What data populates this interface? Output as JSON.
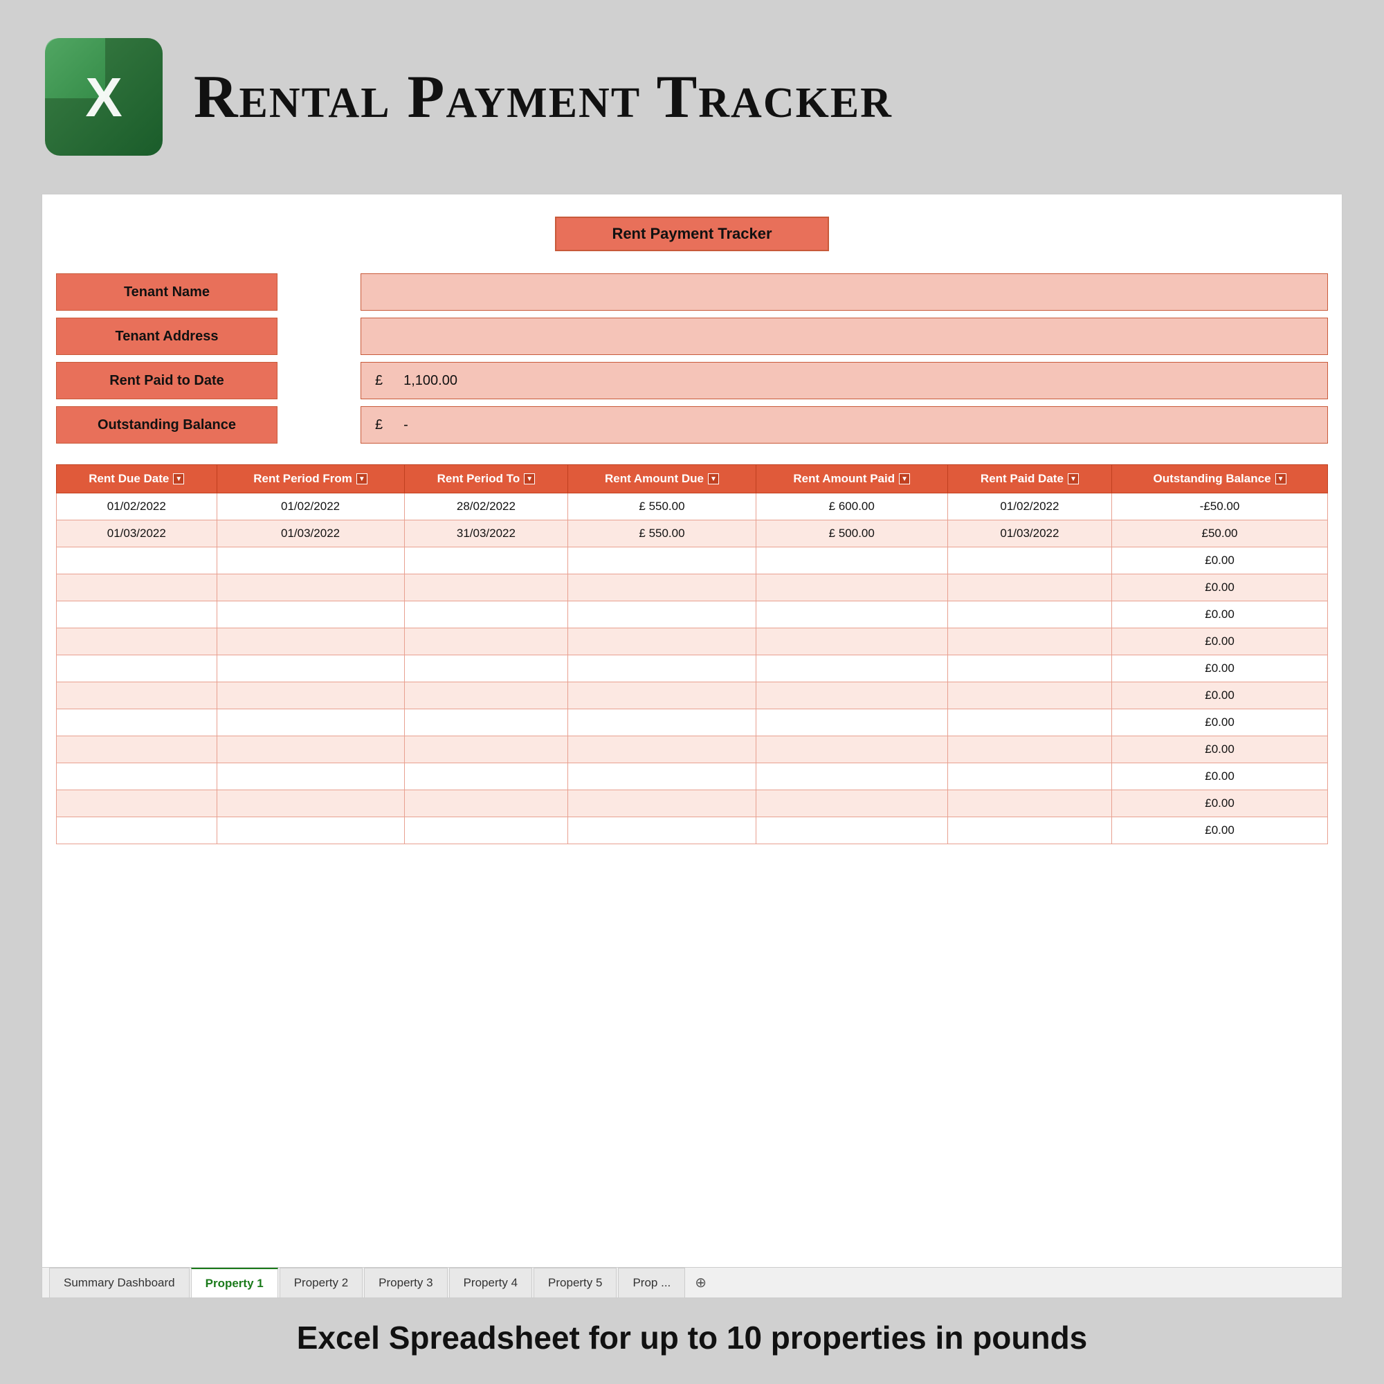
{
  "header": {
    "title": "Rental Payment Tracker",
    "excel_alt": "Excel Logo"
  },
  "spreadsheet": {
    "title": "Rent Payment Tracker",
    "info_fields": [
      {
        "label": "Tenant Name",
        "value": "",
        "has_currency": false
      },
      {
        "label": "Tenant Address",
        "value": "",
        "has_currency": false
      },
      {
        "label": "Rent Paid to Date",
        "value": "1,100.00",
        "has_currency": true
      },
      {
        "label": "Outstanding Balance",
        "value": "-",
        "has_currency": true
      }
    ],
    "table": {
      "columns": [
        "Rent Due Date",
        "Rent Period From",
        "Rent Period To",
        "Rent Amount Due",
        "Rent Amount Paid",
        "Rent Paid Date",
        "Outstanding Balance"
      ],
      "rows": [
        {
          "due_date": "01/02/2022",
          "period_from": "01/02/2022",
          "period_to": "28/02/2022",
          "amount_due": "550.00",
          "amount_paid": "600.00",
          "paid_date": "01/02/2022",
          "balance": "-£50.00"
        },
        {
          "due_date": "01/03/2022",
          "period_from": "01/03/2022",
          "period_to": "31/03/2022",
          "amount_due": "550.00",
          "amount_paid": "500.00",
          "paid_date": "01/03/2022",
          "balance": "£50.00"
        },
        {
          "due_date": "",
          "period_from": "",
          "period_to": "",
          "amount_due": "",
          "amount_paid": "",
          "paid_date": "",
          "balance": "£0.00"
        },
        {
          "due_date": "",
          "period_from": "",
          "period_to": "",
          "amount_due": "",
          "amount_paid": "",
          "paid_date": "",
          "balance": "£0.00"
        },
        {
          "due_date": "",
          "period_from": "",
          "period_to": "",
          "amount_due": "",
          "amount_paid": "",
          "paid_date": "",
          "balance": "£0.00"
        },
        {
          "due_date": "",
          "period_from": "",
          "period_to": "",
          "amount_due": "",
          "amount_paid": "",
          "paid_date": "",
          "balance": "£0.00"
        },
        {
          "due_date": "",
          "period_from": "",
          "period_to": "",
          "amount_due": "",
          "amount_paid": "",
          "paid_date": "",
          "balance": "£0.00"
        },
        {
          "due_date": "",
          "period_from": "",
          "period_to": "",
          "amount_due": "",
          "amount_paid": "",
          "paid_date": "",
          "balance": "£0.00"
        },
        {
          "due_date": "",
          "period_from": "",
          "period_to": "",
          "amount_due": "",
          "amount_paid": "",
          "paid_date": "",
          "balance": "£0.00"
        },
        {
          "due_date": "",
          "period_from": "",
          "period_to": "",
          "amount_due": "",
          "amount_paid": "",
          "paid_date": "",
          "balance": "£0.00"
        },
        {
          "due_date": "",
          "period_from": "",
          "period_to": "",
          "amount_due": "",
          "amount_paid": "",
          "paid_date": "",
          "balance": "£0.00"
        },
        {
          "due_date": "",
          "period_from": "",
          "period_to": "",
          "amount_due": "",
          "amount_paid": "",
          "paid_date": "",
          "balance": "£0.00"
        },
        {
          "due_date": "",
          "period_from": "",
          "period_to": "",
          "amount_due": "",
          "amount_paid": "",
          "paid_date": "",
          "balance": "£0.00"
        }
      ]
    },
    "tabs": [
      {
        "label": "Summary Dashboard",
        "active": false
      },
      {
        "label": "Property 1",
        "active": true
      },
      {
        "label": "Property 2",
        "active": false
      },
      {
        "label": "Property 3",
        "active": false
      },
      {
        "label": "Property 4",
        "active": false
      },
      {
        "label": "Property 5",
        "active": false
      },
      {
        "label": "Prop ...",
        "active": false
      }
    ]
  },
  "footer": {
    "text": "Excel Spreadsheet for up to 10 properties in pounds"
  }
}
